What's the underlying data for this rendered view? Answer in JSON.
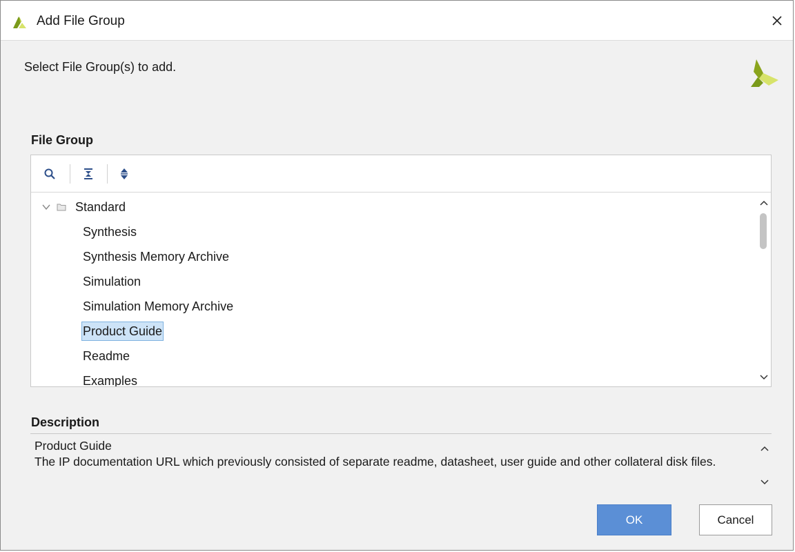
{
  "window": {
    "title": "Add File Group",
    "logo_icon": "vivado-logo-icon",
    "close_icon": "close-icon"
  },
  "subtitle": "Select File Group(s) to add.",
  "file_group": {
    "label": "File Group",
    "toolbar": [
      {
        "icon": "search-icon"
      },
      {
        "icon": "collapse-all-icon"
      },
      {
        "icon": "expand-all-icon"
      }
    ],
    "tree": {
      "root": {
        "label": "Standard",
        "expanded": true,
        "icon": "folder-icon"
      },
      "items": [
        {
          "label": "Synthesis"
        },
        {
          "label": "Synthesis Memory Archive"
        },
        {
          "label": "Simulation"
        },
        {
          "label": "Simulation Memory Archive"
        },
        {
          "label": "Product Guide",
          "selected": true
        },
        {
          "label": "Readme"
        },
        {
          "label": "Examples"
        }
      ]
    }
  },
  "description": {
    "label": "Description",
    "line1": "Product Guide",
    "line2": "The IP documentation URL which previously consisted of separate readme, datasheet, user guide and other collateral disk files."
  },
  "buttons": {
    "ok": "OK",
    "cancel": "Cancel"
  },
  "colors": {
    "accent": "#5b8fd6",
    "selection": "#cde3f7",
    "logo_dark": "#7a9a1a",
    "logo_light": "#d7e36a"
  }
}
